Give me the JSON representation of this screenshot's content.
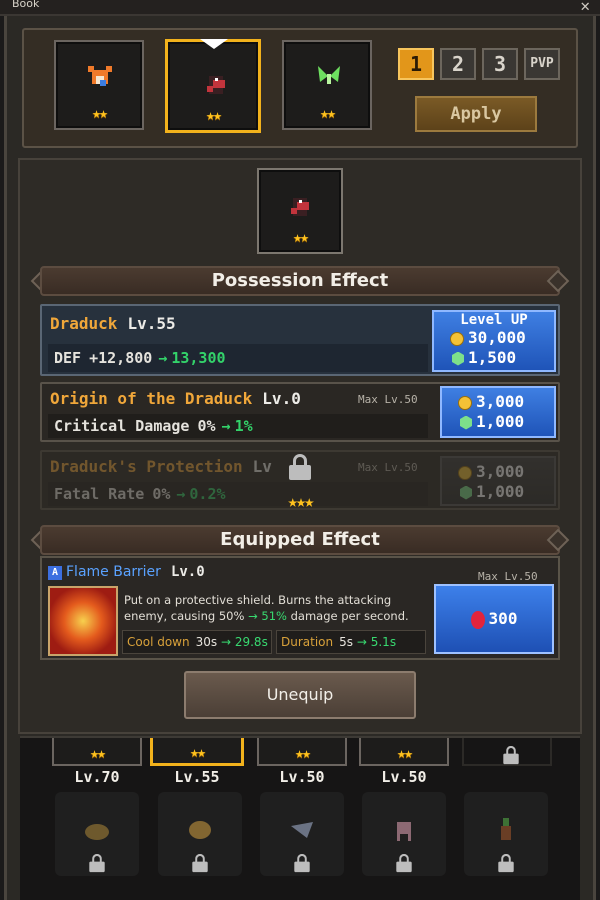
{
  "window": {
    "title": "Book",
    "close": "✕"
  },
  "team": {
    "slots": [
      {
        "name": "fox",
        "stars": "★★",
        "color": "#f07a2a"
      },
      {
        "name": "draduck",
        "stars": "★★",
        "color": "#c2343c",
        "selected": true
      },
      {
        "name": "fairy",
        "stars": "★★",
        "color": "#6ee060"
      }
    ],
    "presets": [
      "1",
      "2",
      "3",
      "PVP"
    ],
    "apply_label": "Apply"
  },
  "selected_monster": {
    "stars": "★★"
  },
  "possession": {
    "header": "Possession Effect",
    "main": {
      "name": "Draduck",
      "level": "Lv.55",
      "stat": "DEF",
      "value": "+12,800",
      "arrow": "→",
      "next": "13,300",
      "button": {
        "label": "Level UP",
        "coins": "30,000",
        "gems": "1,500"
      }
    },
    "origin": {
      "name": "Origin of the Draduck",
      "level": "Lv.0",
      "max": "Max Lv.50",
      "stat": "Critical Damage",
      "value": "0%",
      "arrow": "→",
      "next": "1%",
      "coins": "3,000",
      "gems": "1,000"
    },
    "protection": {
      "name": "Draduck's Protection",
      "level": "Lv",
      "max": "Max Lv.50",
      "stat": "Fatal Rate",
      "value": "0%",
      "arrow": "→",
      "next": "0.2%",
      "coins": "3,000",
      "gems": "1,000",
      "unlock_stars": "★★★"
    }
  },
  "equipped": {
    "header": "Equipped Effect",
    "skill_badge": "A",
    "skill_name": "Flame Barrier",
    "skill_level": "Lv.0",
    "max": "Max Lv.50",
    "desc_1": "Put on a protective shield. Burns the attacking enemy, causing 50%",
    "desc_arrow": "→",
    "desc_hl": "51%",
    "desc_2": "damage per second.",
    "cooldown_label": "Cool down",
    "cooldown_val": "30s",
    "cooldown_next": "29.8s",
    "duration_label": "Duration",
    "duration_val": "5s",
    "duration_next": "5.1s",
    "cost": "300"
  },
  "unequip_label": "Unequip",
  "inventory": {
    "columns": [
      {
        "stars": "★★",
        "level": "Lv.70"
      },
      {
        "stars": "★★",
        "level": "Lv.55",
        "selected": true
      },
      {
        "stars": "★★",
        "level": "Lv.50"
      },
      {
        "stars": "★★",
        "level": "Lv.50"
      }
    ]
  }
}
